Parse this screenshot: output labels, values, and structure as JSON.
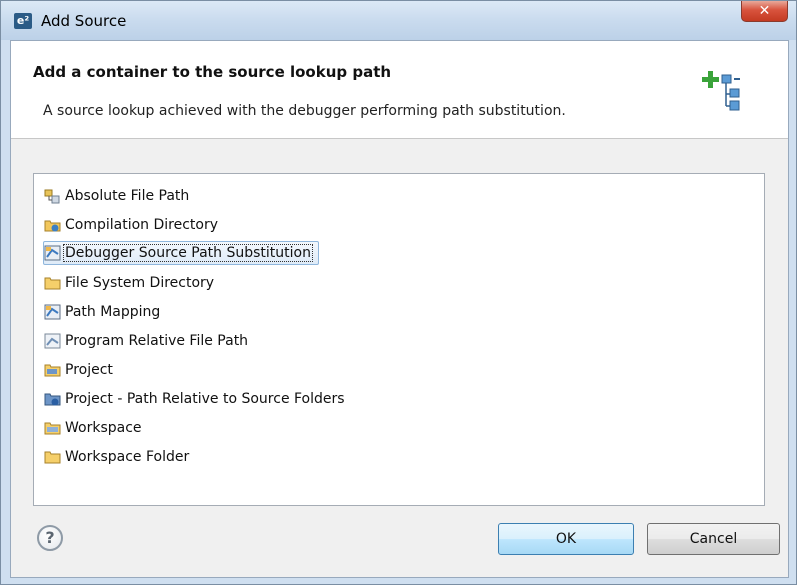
{
  "window": {
    "title": "Add Source",
    "app_icon_text": "e²",
    "close_glyph": "✕"
  },
  "header": {
    "title": "Add a container to the source lookup path",
    "description": "A source lookup achieved with the debugger performing path substitution.",
    "icon": "add-source-container-icon"
  },
  "list": {
    "items": [
      {
        "label": "Absolute File Path",
        "icon": "absolute-file-path-icon"
      },
      {
        "label": "Compilation Directory",
        "icon": "compilation-directory-icon"
      },
      {
        "label": "Debugger Source Path Substitution",
        "icon": "path-substitution-icon",
        "selected": true
      },
      {
        "label": "File System Directory",
        "icon": "folder-icon"
      },
      {
        "label": "Path Mapping",
        "icon": "path-mapping-icon"
      },
      {
        "label": "Program Relative File Path",
        "icon": "program-relative-icon"
      },
      {
        "label": "Project",
        "icon": "project-folder-icon"
      },
      {
        "label": "Project - Path Relative to Source Folders",
        "icon": "project-relative-icon"
      },
      {
        "label": "Workspace",
        "icon": "workspace-icon"
      },
      {
        "label": "Workspace Folder",
        "icon": "workspace-folder-icon"
      }
    ]
  },
  "footer": {
    "help_glyph": "?",
    "ok_label": "OK",
    "cancel_label": "Cancel"
  },
  "colors": {
    "selection": "#dfebf8",
    "titlebar": "#c9dbee",
    "close": "#c43a22",
    "ok_button": "#bee6fd"
  }
}
